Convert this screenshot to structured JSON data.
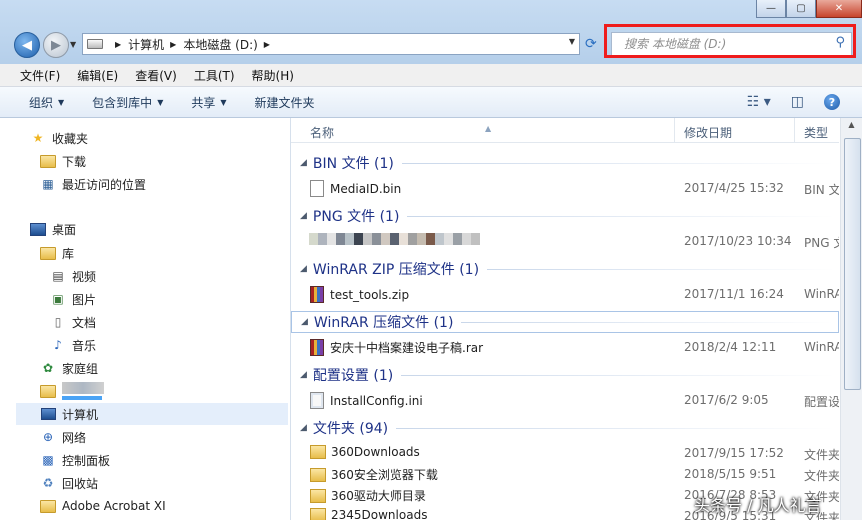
{
  "address": {
    "crumbs": [
      "计算机",
      "本地磁盘 (D:)"
    ]
  },
  "search": {
    "placeholder": "搜索 本地磁盘 (D:)"
  },
  "menu": [
    "文件(F)",
    "编辑(E)",
    "查看(V)",
    "工具(T)",
    "帮助(H)"
  ],
  "toolbar": {
    "organize": "组织",
    "include": "包含到库中",
    "share": "共享",
    "new_folder": "新建文件夹"
  },
  "sidebar": {
    "favorites": "收藏夹",
    "downloads": "下载",
    "recent": "最近访问的位置",
    "desktop": "桌面",
    "libraries": "库",
    "videos": "视频",
    "pictures": "图片",
    "documents": "文档",
    "music": "音乐",
    "homegroup": "家庭组",
    "computer": "计算机",
    "network": "网络",
    "control_panel": "控制面板",
    "recycle_bin": "回收站",
    "acrobat": "Adobe Acrobat XI"
  },
  "columns": {
    "name": "名称",
    "modified": "修改日期",
    "type": "类型"
  },
  "groups": [
    {
      "title": "BIN 文件 (1)"
    },
    {
      "title": "PNG 文件 (1)"
    },
    {
      "title": "WinRAR ZIP 压缩文件 (1)"
    },
    {
      "title": "WinRAR 压缩文件 (1)"
    },
    {
      "title": "配置设置 (1)"
    },
    {
      "title": "文件夹 (94)"
    }
  ],
  "files": [
    {
      "name": "MediaID.bin",
      "date": "2017/4/25 15:32",
      "type": "BIN 文"
    },
    {
      "name": "",
      "date": "2017/10/23 10:34",
      "type": "PNG 文"
    },
    {
      "name": "test_tools.zip",
      "date": "2017/11/1 16:24",
      "type": "WinRA"
    },
    {
      "name": "安庆十中档案建设电子稿.rar",
      "date": "2018/2/4 12:11",
      "type": "WinRA"
    },
    {
      "name": "InstallConfig.ini",
      "date": "2017/6/2 9:05",
      "type": "配置设"
    },
    {
      "name": "360Downloads",
      "date": "2017/9/15 17:52",
      "type": "文件夹"
    },
    {
      "name": "360安全浏览器下载",
      "date": "2018/5/15 9:51",
      "type": "文件夹"
    },
    {
      "name": "360驱动大师目录",
      "date": "2016/7/28 8:53",
      "type": "文件夹"
    },
    {
      "name": "2345Downloads",
      "date": "2016/9/5 15:31",
      "type": "文件夹"
    }
  ],
  "watermark": "头条号 / 凡人礼言",
  "colors": {
    "highlight": "#ef1c1c",
    "group_text": "#1e3287"
  }
}
